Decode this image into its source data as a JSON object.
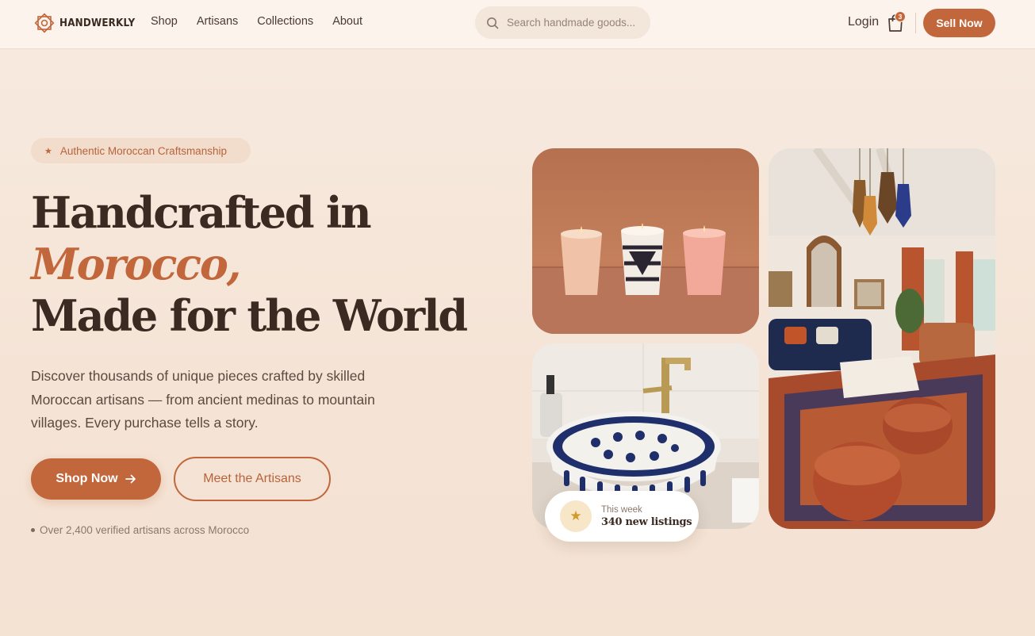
{
  "brand": {
    "name": "HANDWERKLY"
  },
  "nav": {
    "links": [
      "Shop",
      "Artisans",
      "Collections",
      "About"
    ],
    "search_placeholder": "Search handmade goods...",
    "login_label": "Login",
    "cart_count": "3",
    "sell_label": "Sell Now"
  },
  "hero": {
    "pill_label": "Authentic Moroccan Craftsmanship",
    "headline_line1": "Handcrafted in",
    "headline_accent": "Morocco,",
    "headline_line3": "Made for the World",
    "description": "Discover thousands of unique pieces crafted by skilled Moroccan artisans — from ancient medinas to mountain villages. Every purchase tells a story.",
    "shop_label": "Shop Now",
    "artisans_label": "Meet the Artisans",
    "note": "Over 2,400 verified artisans across Morocco"
  },
  "badge": {
    "sub": "This week",
    "main": "340 new listings"
  },
  "colors": {
    "accent": "#c2663b",
    "text_dark": "#3b2a22",
    "background": "#f6e7da",
    "badge_star": "#d19a2a"
  },
  "icons": {
    "search": "search-icon",
    "cart": "shopping-bag-icon",
    "arrow": "arrow-right-icon",
    "star": "star-icon"
  }
}
